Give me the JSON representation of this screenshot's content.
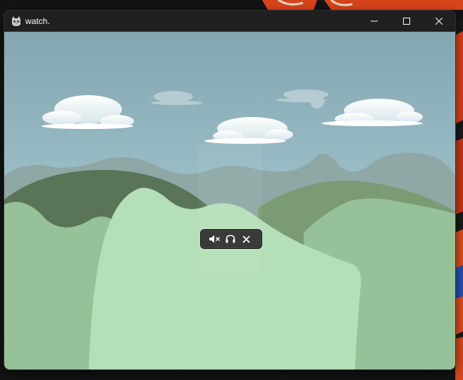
{
  "window": {
    "title": "watch.",
    "app_icon": "cat-icon",
    "controls": {
      "minimize_icon": "minimize-icon",
      "maximize_icon": "maximize-icon",
      "close_icon": "close-icon"
    }
  },
  "player_controls": {
    "mute_icon": "speaker-muted-icon",
    "audio_icon": "headphones-icon",
    "close_icon": "close-icon"
  },
  "colors": {
    "sky_top": "#84a6b0",
    "sky_bottom": "#9fc2cb",
    "far_mountains": "#8fa8a6",
    "dark_hill": "#597457",
    "mid_hill": "#7b9b75",
    "side_hill": "#97c199",
    "front_hill": "#b5dfb8",
    "titlebar": "#202020"
  }
}
